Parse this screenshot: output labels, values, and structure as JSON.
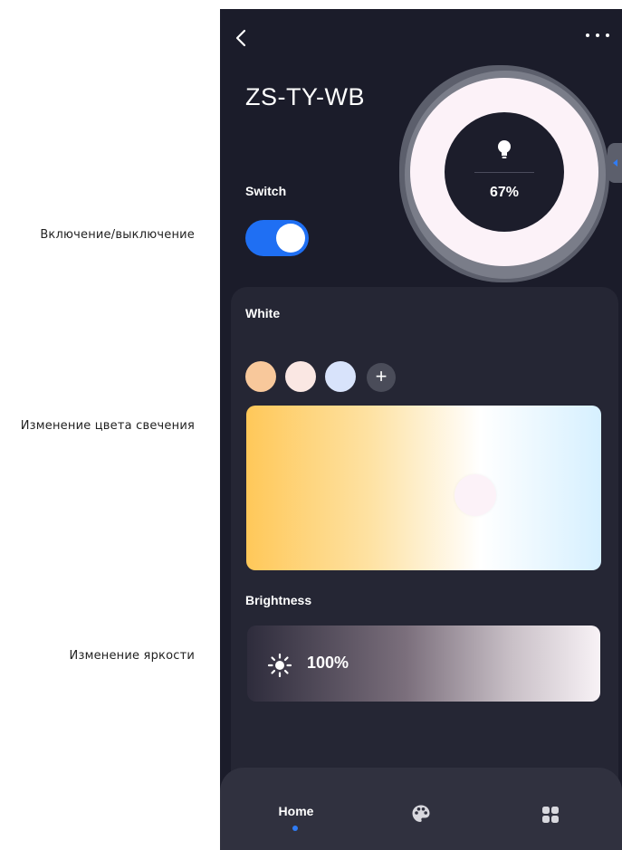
{
  "annotations": {
    "switch": "Включение/выключение",
    "color": "Изменение цвета свечения",
    "brightness": "Изменение яркости"
  },
  "header": {
    "back_icon": "chevron-left-icon",
    "menu_icon": "more-dots-icon",
    "device_name": "ZS-TY-WB"
  },
  "dial": {
    "icon": "bulb-icon",
    "value": "67%",
    "level": 0.67
  },
  "switch": {
    "label": "Switch",
    "state": "on",
    "accent": "#1f6ff3"
  },
  "white": {
    "label": "White",
    "presets": [
      {
        "name": "warm",
        "color": "#f8c89b"
      },
      {
        "name": "neutral",
        "color": "#fae7e3"
      },
      {
        "name": "cool",
        "color": "#d8e3fb"
      }
    ],
    "add_label": "+",
    "gradient": [
      "#ffc859",
      "#fee2a3",
      "#ffffff",
      "#d6f0ff"
    ]
  },
  "brightness": {
    "label": "Brightness",
    "icon": "sun-icon",
    "value": "100%",
    "level": 1.0
  },
  "tabbar": {
    "home_label": "Home",
    "palette_icon": "palette-icon",
    "grid_icon": "grid-icon",
    "active_color": "#2f7cf6"
  }
}
